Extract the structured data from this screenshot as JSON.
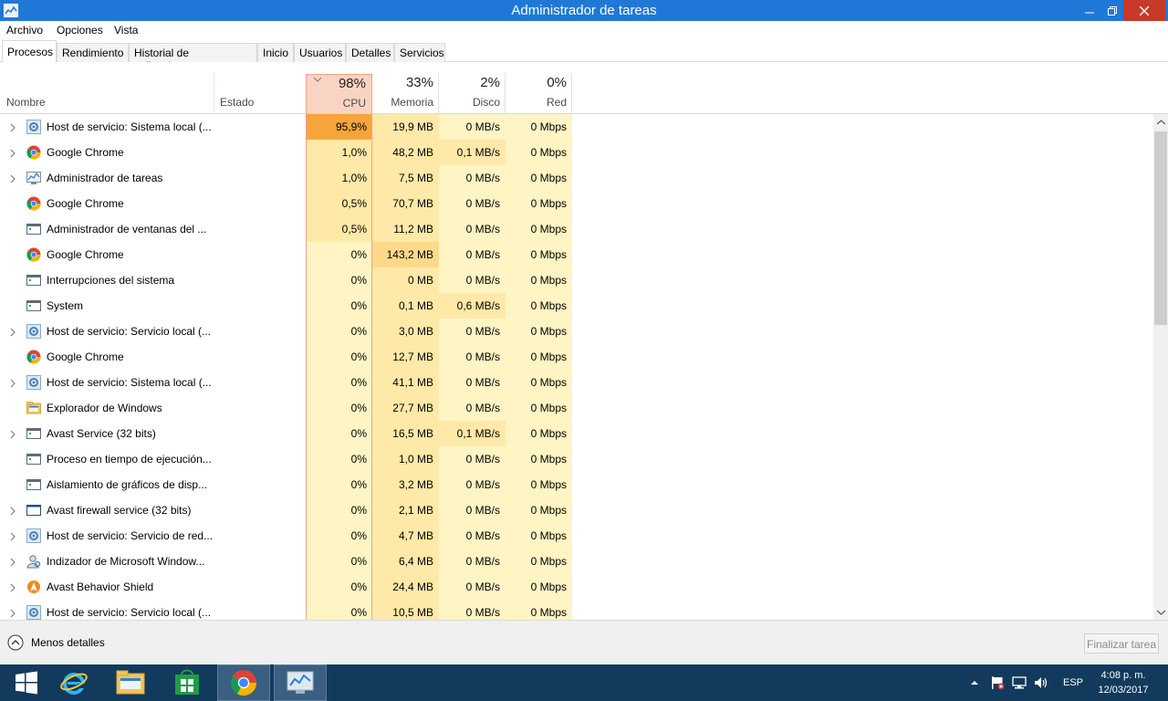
{
  "window": {
    "title": "Administrador de tareas"
  },
  "menu": {
    "archivo": "Archivo",
    "opciones": "Opciones",
    "vista": "Vista"
  },
  "tabs": [
    {
      "label": "Procesos",
      "active": true
    },
    {
      "label": "Rendimiento"
    },
    {
      "label": "Historial de aplicaciones"
    },
    {
      "label": "Inicio"
    },
    {
      "label": "Usuarios"
    },
    {
      "label": "Detalles"
    },
    {
      "label": "Servicios"
    }
  ],
  "columns": {
    "name": "Nombre",
    "status": "Estado",
    "cpu": {
      "pct": "98%",
      "label": "CPU"
    },
    "memory": {
      "pct": "33%",
      "label": "Memoria"
    },
    "disk": {
      "pct": "2%",
      "label": "Disco"
    },
    "network": {
      "pct": "0%",
      "label": "Red"
    }
  },
  "rows": [
    {
      "expand": true,
      "icon": "gear-icon",
      "name": "Host de servicio: Sistema local (...",
      "cpu": "95,9%",
      "mem": "19,9 MB",
      "disk": "0 MB/s",
      "net": "0 Mbps"
    },
    {
      "expand": true,
      "icon": "chrome-icon",
      "name": "Google Chrome",
      "cpu": "1,0%",
      "mem": "48,2 MB",
      "disk": "0,1 MB/s",
      "net": "0 Mbps"
    },
    {
      "expand": true,
      "icon": "taskmgr-icon",
      "name": "Administrador de tareas",
      "cpu": "1,0%",
      "mem": "7,5 MB",
      "disk": "0 MB/s",
      "net": "0 Mbps"
    },
    {
      "expand": false,
      "icon": "chrome-icon",
      "name": "Google Chrome",
      "cpu": "0,5%",
      "mem": "70,7 MB",
      "disk": "0 MB/s",
      "net": "0 Mbps"
    },
    {
      "expand": false,
      "icon": "window-icon",
      "name": "Administrador de ventanas del ...",
      "cpu": "0,5%",
      "mem": "11,2 MB",
      "disk": "0 MB/s",
      "net": "0 Mbps"
    },
    {
      "expand": false,
      "icon": "chrome-icon",
      "name": "Google Chrome",
      "cpu": "0%",
      "mem": "143,2 MB",
      "disk": "0 MB/s",
      "net": "0 Mbps"
    },
    {
      "expand": false,
      "icon": "window-icon",
      "name": "Interrupciones del sistema",
      "cpu": "0%",
      "mem": "0 MB",
      "disk": "0 MB/s",
      "net": "0 Mbps"
    },
    {
      "expand": false,
      "icon": "window-icon",
      "name": "System",
      "cpu": "0%",
      "mem": "0,1 MB",
      "disk": "0,6 MB/s",
      "net": "0 Mbps"
    },
    {
      "expand": true,
      "icon": "gear-icon",
      "name": "Host de servicio: Servicio local (...",
      "cpu": "0%",
      "mem": "3,0 MB",
      "disk": "0 MB/s",
      "net": "0 Mbps"
    },
    {
      "expand": false,
      "icon": "chrome-icon",
      "name": "Google Chrome",
      "cpu": "0%",
      "mem": "12,7 MB",
      "disk": "0 MB/s",
      "net": "0 Mbps"
    },
    {
      "expand": true,
      "icon": "gear-icon",
      "name": "Host de servicio: Sistema local (...",
      "cpu": "0%",
      "mem": "41,1 MB",
      "disk": "0 MB/s",
      "net": "0 Mbps"
    },
    {
      "expand": false,
      "icon": "folder-icon",
      "name": "Explorador de Windows",
      "cpu": "0%",
      "mem": "27,7 MB",
      "disk": "0 MB/s",
      "net": "0 Mbps"
    },
    {
      "expand": true,
      "icon": "window-icon",
      "name": "Avast Service (32 bits)",
      "cpu": "0%",
      "mem": "16,5 MB",
      "disk": "0,1 MB/s",
      "net": "0 Mbps"
    },
    {
      "expand": false,
      "icon": "window-icon",
      "name": "Proceso en tiempo de ejecución...",
      "cpu": "0%",
      "mem": "1,0 MB",
      "disk": "0 MB/s",
      "net": "0 Mbps"
    },
    {
      "expand": false,
      "icon": "window-icon",
      "name": "Aislamiento de gráficos de disp...",
      "cpu": "0%",
      "mem": "3,2 MB",
      "disk": "0 MB/s",
      "net": "0 Mbps"
    },
    {
      "expand": true,
      "icon": "blank-window-icon",
      "name": "Avast firewall service (32 bits)",
      "cpu": "0%",
      "mem": "2,1 MB",
      "disk": "0 MB/s",
      "net": "0 Mbps"
    },
    {
      "expand": true,
      "icon": "gear-icon",
      "name": "Host de servicio: Servicio de red...",
      "cpu": "0%",
      "mem": "4,7 MB",
      "disk": "0 MB/s",
      "net": "0 Mbps"
    },
    {
      "expand": true,
      "icon": "user-search-icon",
      "name": "Indizador de Microsoft Window...",
      "cpu": "0%",
      "mem": "6,4 MB",
      "disk": "0 MB/s",
      "net": "0 Mbps"
    },
    {
      "expand": true,
      "icon": "avast-icon",
      "name": "Avast Behavior Shield",
      "cpu": "0%",
      "mem": "24,4 MB",
      "disk": "0 MB/s",
      "net": "0 Mbps"
    },
    {
      "expand": true,
      "icon": "gear-icon",
      "name": "Host de servicio: Servicio local (...",
      "cpu": "0%",
      "mem": "10,5 MB",
      "disk": "0 MB/s",
      "net": "0 Mbps"
    }
  ],
  "footer": {
    "less_details": "Menos detalles",
    "end_task": "Finalizar tarea"
  },
  "taskbar": {
    "lang": "ESP",
    "time": "4:08 p. m.",
    "date": "12/03/2017",
    "items": [
      "start-icon",
      "internet-explorer-icon",
      "file-explorer-icon",
      "store-icon",
      "chrome-icon",
      "taskmgr-icon"
    ]
  },
  "colors": {
    "titlebar": "#1f78d8",
    "cpu_hot": "#f5a53c",
    "heat_low": "#fff4c4",
    "heat_mid": "#ffe9a8",
    "heat_high": "#ffd98a",
    "cpu_header": "#f9d4c4",
    "taskbar": "#123a5c"
  }
}
